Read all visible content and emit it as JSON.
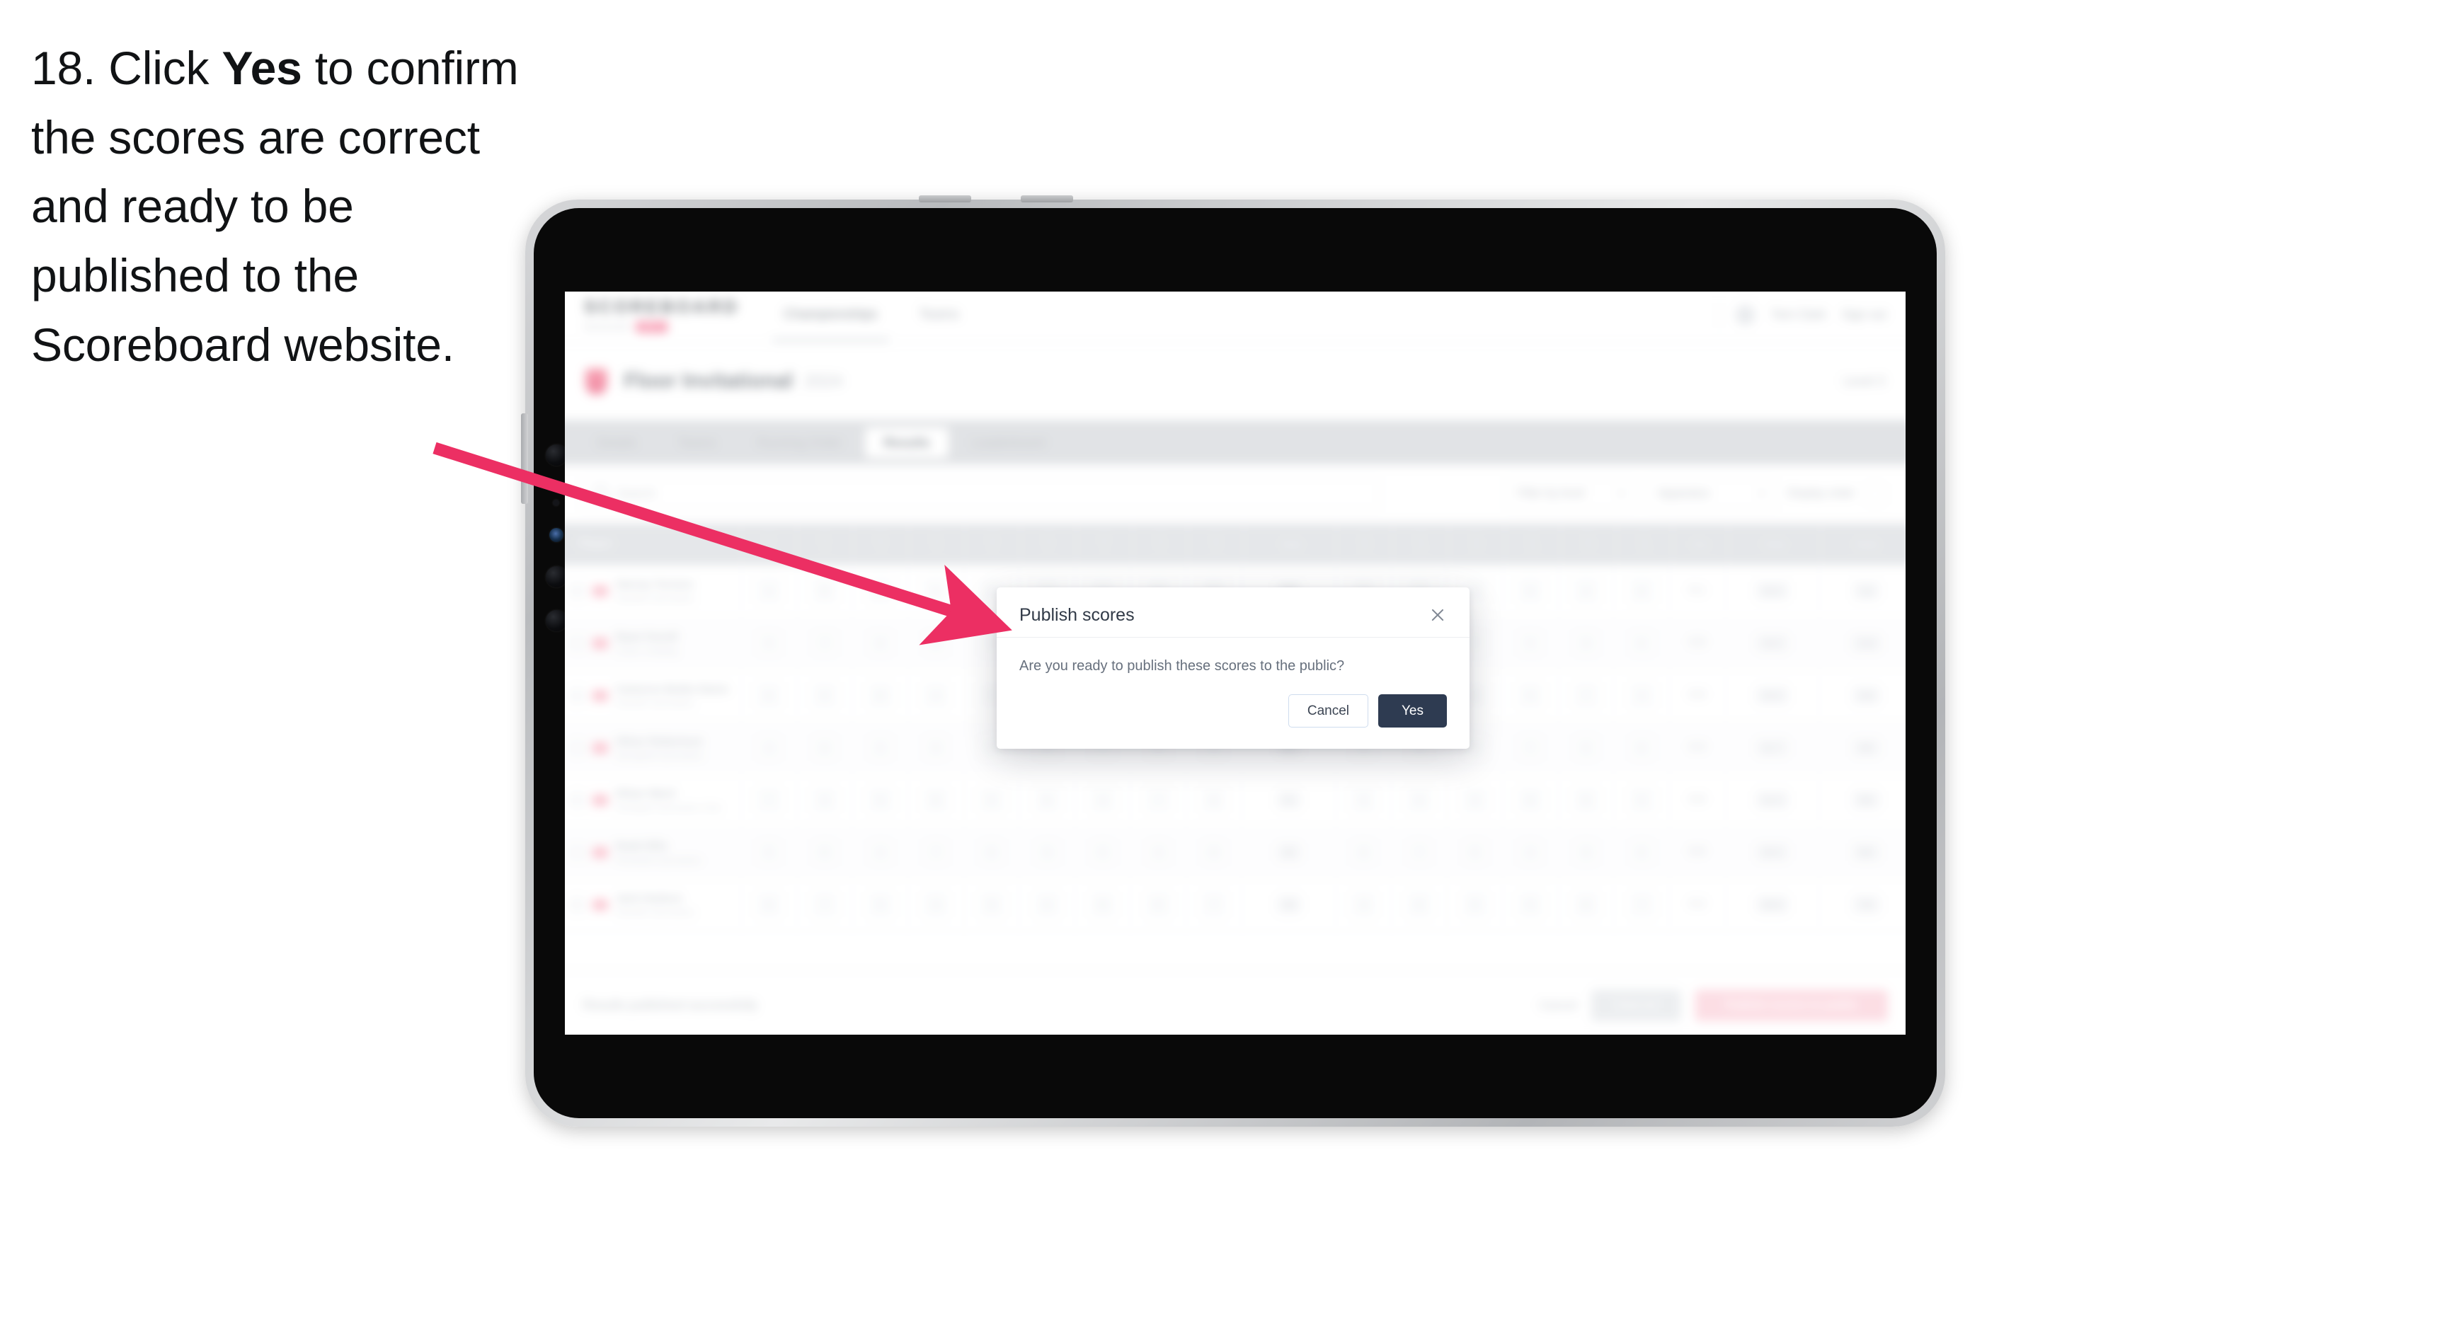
{
  "instruction": {
    "number": "18.",
    "lead": "Click",
    "emphasis": "Yes",
    "rest": "to confirm the scores are correct and ready to be published to the Scoreboard website."
  },
  "colors": {
    "arrow": "#ec2f63",
    "primary_button": "#2e3b51",
    "accent_pink": "#f2597f",
    "device_bezel": "#090909",
    "device_frame": "#c7c9cc"
  },
  "device": {
    "type": "tablet",
    "orientation": "landscape"
  },
  "app": {
    "brand": {
      "word": "SCOREBOARD",
      "subtitle": "MANAGER",
      "badge": "BETA"
    },
    "top_nav": [
      {
        "label": "Championships",
        "active": true
      },
      {
        "label": "Teams",
        "active": false
      }
    ],
    "top_right": {
      "user": "Tom Clark",
      "logout": "Sign out"
    },
    "event": {
      "title": "Floor Invitational",
      "subtitle": "2024",
      "right_label": "Level 3"
    },
    "tabs": [
      {
        "label": "Details",
        "active": false
      },
      {
        "label": "Teams",
        "active": false
      },
      {
        "label": "Running Order",
        "active": false
      },
      {
        "label": "Results",
        "active": true
      },
      {
        "label": "Leaderboard",
        "active": false
      }
    ],
    "toolbar": {
      "search_placeholder": "Search",
      "filters": [
        {
          "label": "Filter by level"
        },
        {
          "label": "Apparatus"
        }
      ],
      "sort": {
        "label": "Display order"
      }
    },
    "table": {
      "columns": [
        {
          "label": "Player"
        },
        {
          "label": "D",
          "sub": "1"
        },
        {
          "label": "E",
          "sub": "2"
        },
        {
          "label": "D",
          "sub": "3"
        },
        {
          "label": "E",
          "sub": "4"
        },
        {
          "label": "D",
          "sub": "5"
        },
        {
          "label": "E",
          "sub": "6"
        },
        {
          "label": "D",
          "sub": "7"
        },
        {
          "label": "E",
          "sub": "8"
        },
        {
          "label": "D",
          "sub": "9"
        },
        {
          "label": "Total",
          "sub": ""
        },
        {
          "label": "D",
          "sub": "10"
        },
        {
          "label": "E",
          "sub": "11"
        },
        {
          "label": "D",
          "sub": "12"
        },
        {
          "label": "E",
          "sub": "13"
        },
        {
          "label": "D",
          "sub": "14"
        },
        {
          "label": "E",
          "sub": "15"
        },
        {
          "label": "Pen",
          "sub": ""
        },
        {
          "label": "Final",
          "sub": ""
        },
        {
          "label": "Rank",
          "sub": ""
        }
      ],
      "rows": [
        {
          "name": "Harvey Turners",
          "club": "Eastville Gymnastics",
          "scores": [
            "4",
            "8",
            "6",
            "5",
            "9",
            "7",
            "4",
            "6",
            "8",
            "5",
            "7",
            "6",
            "9",
            "4",
            "8",
            "5"
          ],
          "total": "46",
          "pen": "0.1",
          "final": "45.9",
          "rank": "1st"
        },
        {
          "name": "Ryan Farrell",
          "club": "Crown Tumbling",
          "scores": [
            "5",
            "7",
            "6",
            "8",
            "4",
            "9",
            "5",
            "7",
            "6",
            "8",
            "4",
            "7",
            "5",
            "9",
            "6",
            "4"
          ],
          "total": "44",
          "pen": "0.0",
          "final": "44.0",
          "rank": "2nd"
        },
        {
          "name": "Cameron Butler-Davis",
          "club": "Eastville Gymnastics",
          "scores": [
            "6",
            "5",
            "8",
            "4",
            "7",
            "6",
            "9",
            "5",
            "4",
            "7",
            "8",
            "6",
            "5",
            "7",
            "4",
            "9"
          ],
          "total": "43",
          "pen": "0.0",
          "final": "43.0",
          "rank": "3rd"
        },
        {
          "name": "Oliver Robertson",
          "club": "Springfield Gymnastics",
          "scores": [
            "4",
            "6",
            "5",
            "9",
            "8",
            "4",
            "7",
            "6",
            "5",
            "9",
            "4",
            "8",
            "7",
            "5",
            "6",
            "4"
          ],
          "total": "42",
          "pen": "0.3",
          "final": "41.7",
          "rank": "4th"
        },
        {
          "name": "Ethan Ward",
          "club": "Northgate Gymnastics Club",
          "scores": [
            "7",
            "4",
            "9",
            "6",
            "5",
            "8",
            "4",
            "7",
            "6",
            "5",
            "9",
            "4",
            "8",
            "6",
            "5",
            "7"
          ],
          "total": "41",
          "pen": "0.0",
          "final": "41.0",
          "rank": "5th"
        },
        {
          "name": "Noah Ellis",
          "club": "Riverbank Gymnastics",
          "scores": [
            "5",
            "8",
            "4",
            "7",
            "6",
            "9",
            "5",
            "4",
            "8",
            "6",
            "7",
            "5",
            "4",
            "9",
            "6",
            "8"
          ],
          "total": "40",
          "pen": "0.0",
          "final": "40.0",
          "rank": "6th"
        },
        {
          "name": "Jack Hudson",
          "club": "Eastville Gymnastics",
          "scores": [
            "6",
            "7",
            "5",
            "4",
            "9",
            "6",
            "8",
            "5",
            "7",
            "4",
            "6",
            "9",
            "5",
            "8",
            "7",
            "4"
          ],
          "total": "39",
          "pen": "0.2",
          "final": "38.8",
          "rank": "7th"
        }
      ]
    },
    "bottom_bar": {
      "note": "Results published successfully",
      "link_label": "Cancel",
      "secondary_label": "Save all",
      "primary_label": "Publish scores to public"
    }
  },
  "modal": {
    "title": "Publish scores",
    "message": "Are you ready to publish these scores to the public?",
    "cancel_label": "Cancel",
    "confirm_label": "Yes",
    "close_icon": "close-icon"
  }
}
